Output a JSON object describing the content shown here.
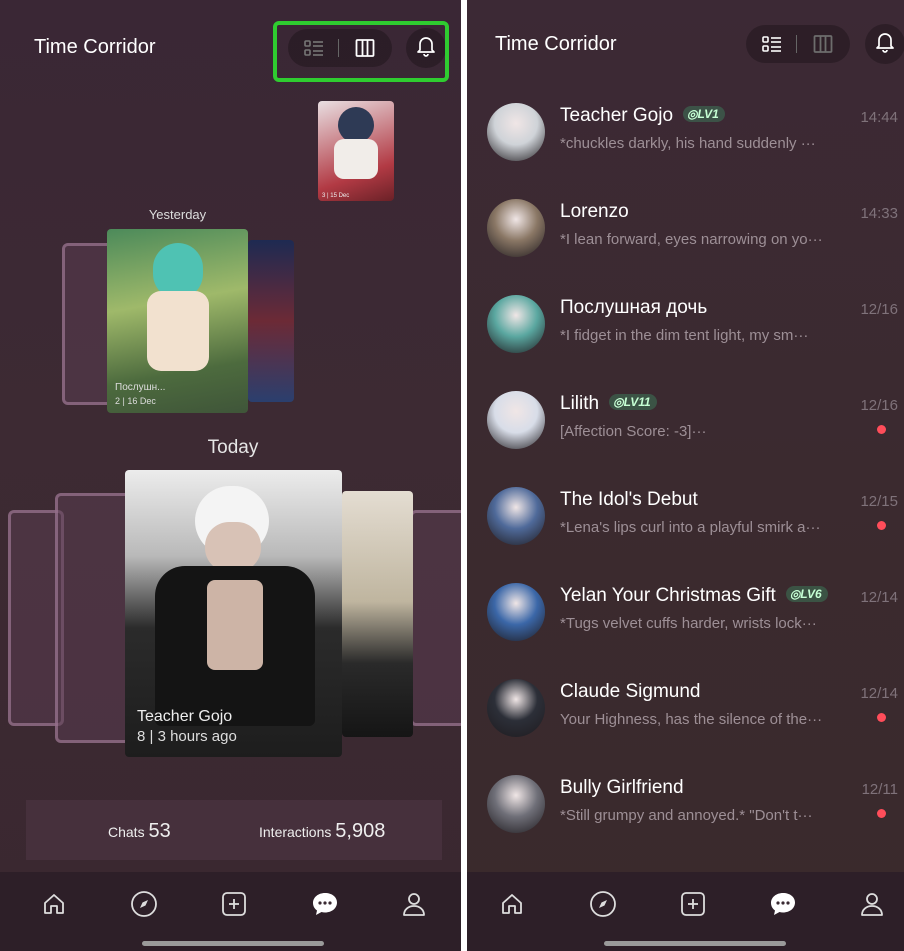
{
  "left": {
    "title": "Time Corridor",
    "yesterday_label": "Yesterday",
    "today_label": "Today",
    "yesterday_card": {
      "name": "Послушн...",
      "meta": "2 | 16 Dec"
    },
    "top_card": {
      "meta": "3 | 15 Dec"
    },
    "main_card": {
      "name": "Teacher Gojo",
      "meta": "8 | 3 hours ago"
    },
    "stats": {
      "chats_label": "Chats",
      "chats_value": "53",
      "interactions_label": "Interactions",
      "interactions_value": "5,908"
    }
  },
  "right": {
    "title": "Time Corridor",
    "chats": [
      {
        "name": "Teacher Gojo",
        "level": "LV1",
        "preview": "*chuckles darkly, his hand suddenly ···",
        "time": "14:44",
        "unread": false,
        "avatar_color": "#cfd3d8"
      },
      {
        "name": "Lorenzo",
        "level": "",
        "preview": "*I lean forward, eyes narrowing on yo···",
        "time": "14:33",
        "unread": false,
        "avatar_color": "#8a7765"
      },
      {
        "name": "Послушная дочь",
        "level": "",
        "preview": "*I fidget in the dim tent light, my sm···",
        "time": "12/16",
        "unread": false,
        "avatar_color": "#5aa7a0"
      },
      {
        "name": "Lilith",
        "level": "LV11",
        "preview": "[Affection Score: -3]···",
        "time": "12/16",
        "unread": true,
        "avatar_color": "#d8dde8"
      },
      {
        "name": "The Idol's Debut",
        "level": "",
        "preview": "*Lena's lips curl into a playful smirk a···",
        "time": "12/15",
        "unread": true,
        "avatar_color": "#4f6a9a"
      },
      {
        "name": "Yelan Your Christmas Gift",
        "level": "LV6",
        "preview": "*Tugs velvet cuffs harder, wrists lock···",
        "time": "12/14",
        "unread": false,
        "avatar_color": "#3b67a8"
      },
      {
        "name": "Claude Sigmund",
        "level": "",
        "preview": "Your Highness, has the silence of the···",
        "time": "12/14",
        "unread": true,
        "avatar_color": "#2c2f38"
      },
      {
        "name": "Bully Girlfriend",
        "level": "",
        "preview": "*Still grumpy and annoyed.* \"Don't t···",
        "time": "12/11",
        "unread": true,
        "avatar_color": "#6f6f78"
      }
    ]
  },
  "nav_items": [
    "home-icon",
    "discover-compass-icon",
    "create-plus-icon",
    "chat-bubble-icon",
    "profile-icon"
  ],
  "colors": {
    "highlight": "#2fcc30",
    "unread_dot": "#ff4d5a",
    "level_badge": "#c6ffd4"
  }
}
